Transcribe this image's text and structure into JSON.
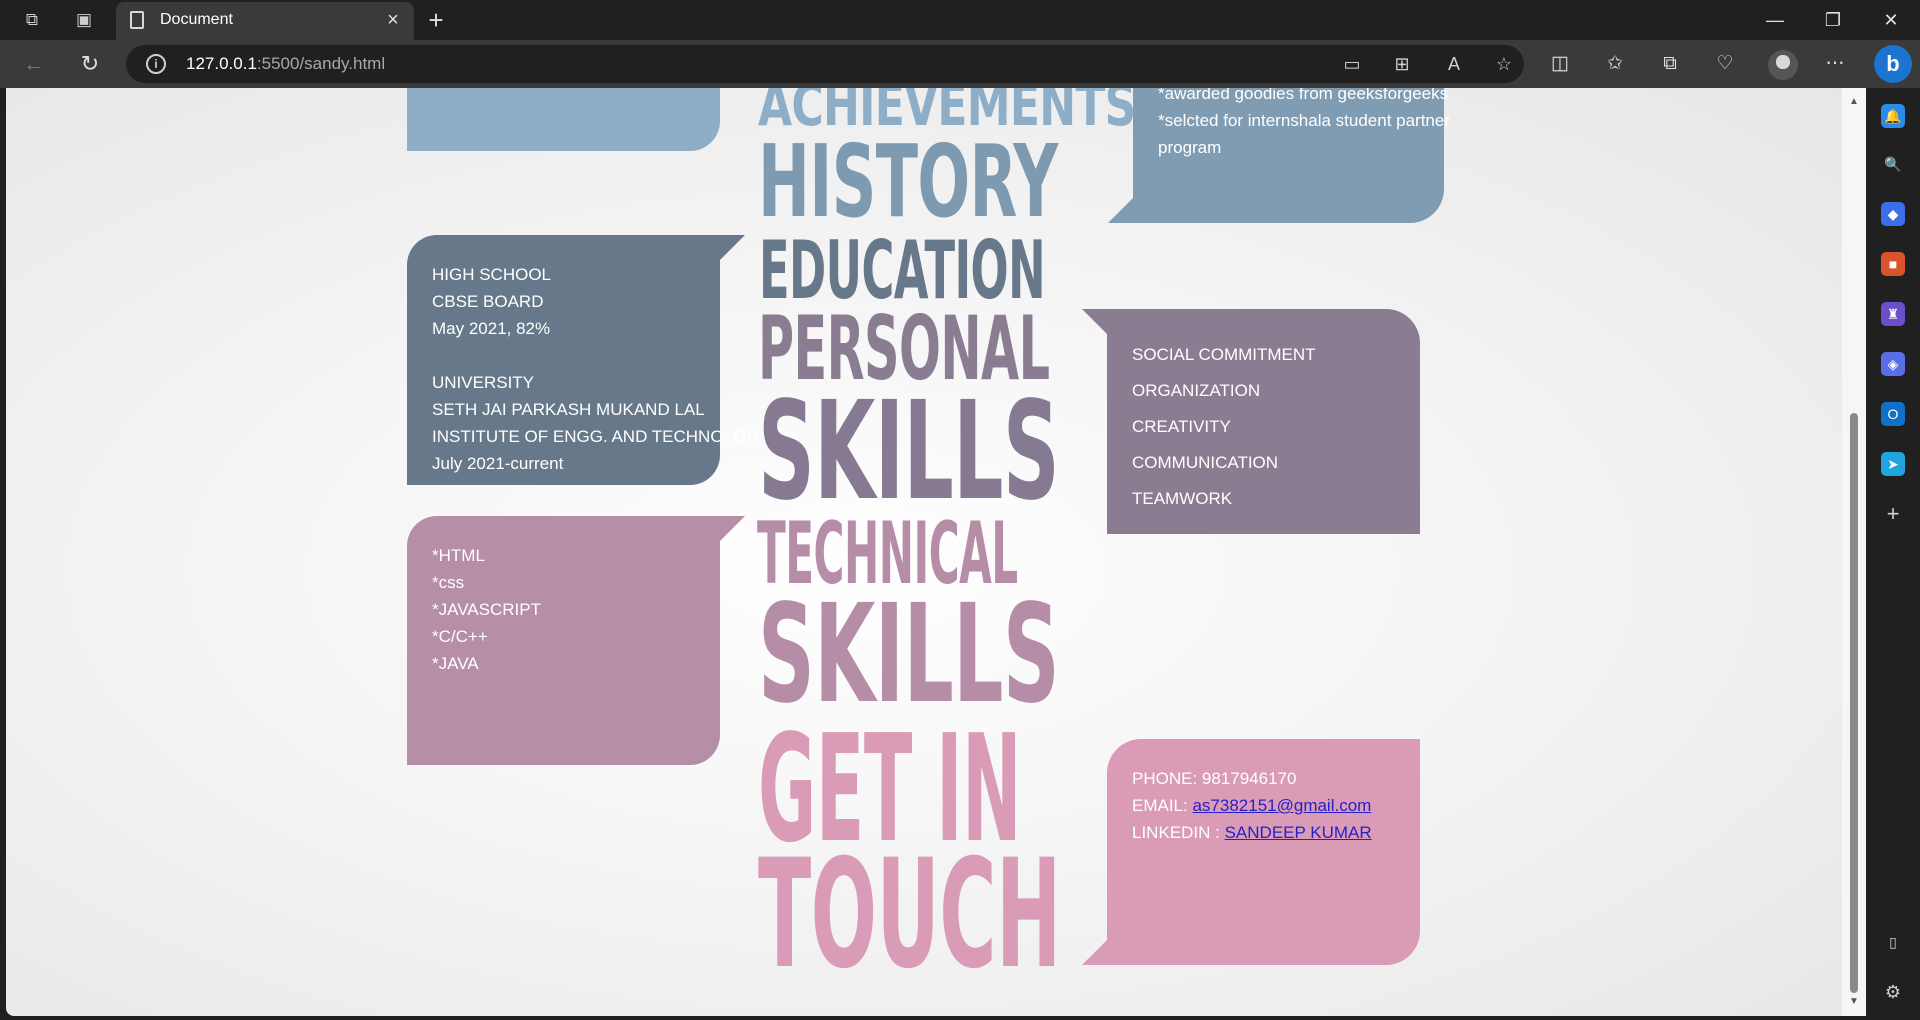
{
  "browser": {
    "tab_title": "Document",
    "url_host": "127.0.0.1",
    "url_path": ":5500/sandy.html"
  },
  "page": {
    "words": [
      "ACHIEVEMENTS",
      "HISTORY",
      "EDUCATION",
      "PERSONAL",
      "SKILLS",
      "TECHNICAL",
      "SKILLS",
      "GET IN",
      "TOUCH"
    ],
    "achievements": {
      "lines": [
        "*awarded goodies from geeksforgeeks",
        "*selcted for internshala student partner",
        "program"
      ]
    },
    "education": {
      "high_school": [
        "HIGH SCHOOL",
        "CBSE BOARD",
        "May 2021, 82%"
      ],
      "university": [
        "UNIVERSITY",
        "SETH JAI PARKASH MUKAND LAL",
        "INSTITUTE OF ENGG. AND TECHNOLOGY",
        "July 2021-current"
      ]
    },
    "personal_skills": [
      "SOCIAL COMMITMENT",
      "ORGANIZATION",
      "CREATIVITY",
      "COMMUNICATION",
      "TEAMWORK"
    ],
    "technical_skills": [
      "*HTML",
      "*css",
      "*JAVASCRIPT",
      "*C/C++",
      "*JAVA"
    ],
    "contact": {
      "phone_label": "PHONE: 9817946170",
      "email_label": "EMAIL: ",
      "email": "as7382151@gmail.com",
      "linkedin_label": "LINKEDIN : ",
      "linkedin": "SANDEEP KUMAR"
    },
    "colors": {
      "achievements": "#8eadc6",
      "history": "#7d9ab0",
      "education": "#66788a",
      "personal": "#8a7d92",
      "skills": "#857a92",
      "technical": "#b58da6",
      "get_in_touch": "#d99bb5"
    }
  }
}
